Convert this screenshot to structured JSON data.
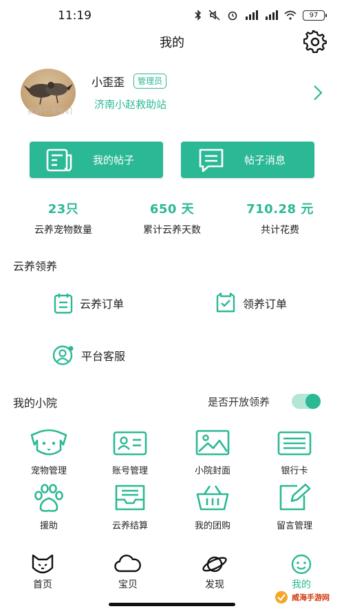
{
  "status_bar": {
    "time": "11:19",
    "battery": "97"
  },
  "header": {
    "title": "我的"
  },
  "profile": {
    "username": "小歪歪",
    "role_badge": "管理员",
    "station": "济南小赵救助站",
    "avatar_caption": "我的小宠物们"
  },
  "actions": {
    "my_posts": "我的帖子",
    "post_messages": "帖子消息"
  },
  "stats": [
    {
      "value": "23只",
      "label": "云养宠物数量"
    },
    {
      "value": "650 天",
      "label": "累计云养天数"
    },
    {
      "value": "710.28 元",
      "label": "共计花费"
    }
  ],
  "cloud_adopt": {
    "title": "云养领养",
    "items": [
      "云养订单",
      "领养订单",
      "平台客服"
    ]
  },
  "my_yard": {
    "title": "我的小院",
    "toggle_label": "是否开放领养",
    "toggle_on": true,
    "items": [
      "宠物管理",
      "账号管理",
      "小院封面",
      "银行卡",
      "援助",
      "云养结算",
      "我的团购",
      "留言管理"
    ]
  },
  "bottom_nav": {
    "tabs": [
      "首页",
      "宝贝",
      "发现",
      "我的"
    ],
    "active": "我的"
  },
  "watermark": {
    "text": "威海手游网"
  },
  "colors": {
    "accent": "#2bb894",
    "text": "#222222"
  }
}
